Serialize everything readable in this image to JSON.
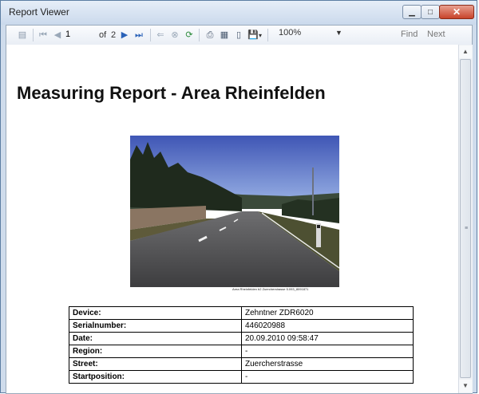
{
  "window": {
    "title": "Report Viewer"
  },
  "toolbar": {
    "page_current": "1",
    "page_of": "of",
    "page_total": "2",
    "zoom": "100%",
    "find": "Find",
    "next": "Next"
  },
  "report": {
    "title": "Measuring Report - Area Rheinfelden",
    "photo_caption": "Area Rheinfelden b2  Zuercherstrasse  5.093_8091871",
    "rows": [
      {
        "key": "Device:",
        "value": "Zehntner ZDR6020"
      },
      {
        "key": "Serialnumber:",
        "value": "446020988"
      },
      {
        "key": "Date:",
        "value": "20.09.2010 09:58:47"
      },
      {
        "key": "Region:",
        "value": "-"
      },
      {
        "key": "Street:",
        "value": "Zuercherstrasse"
      },
      {
        "key": "Startposition:",
        "value": "-"
      }
    ]
  },
  "colors": {
    "titlebar": "#cad9ec",
    "close_button": "#c8432a",
    "accent": "#2a62b8"
  }
}
